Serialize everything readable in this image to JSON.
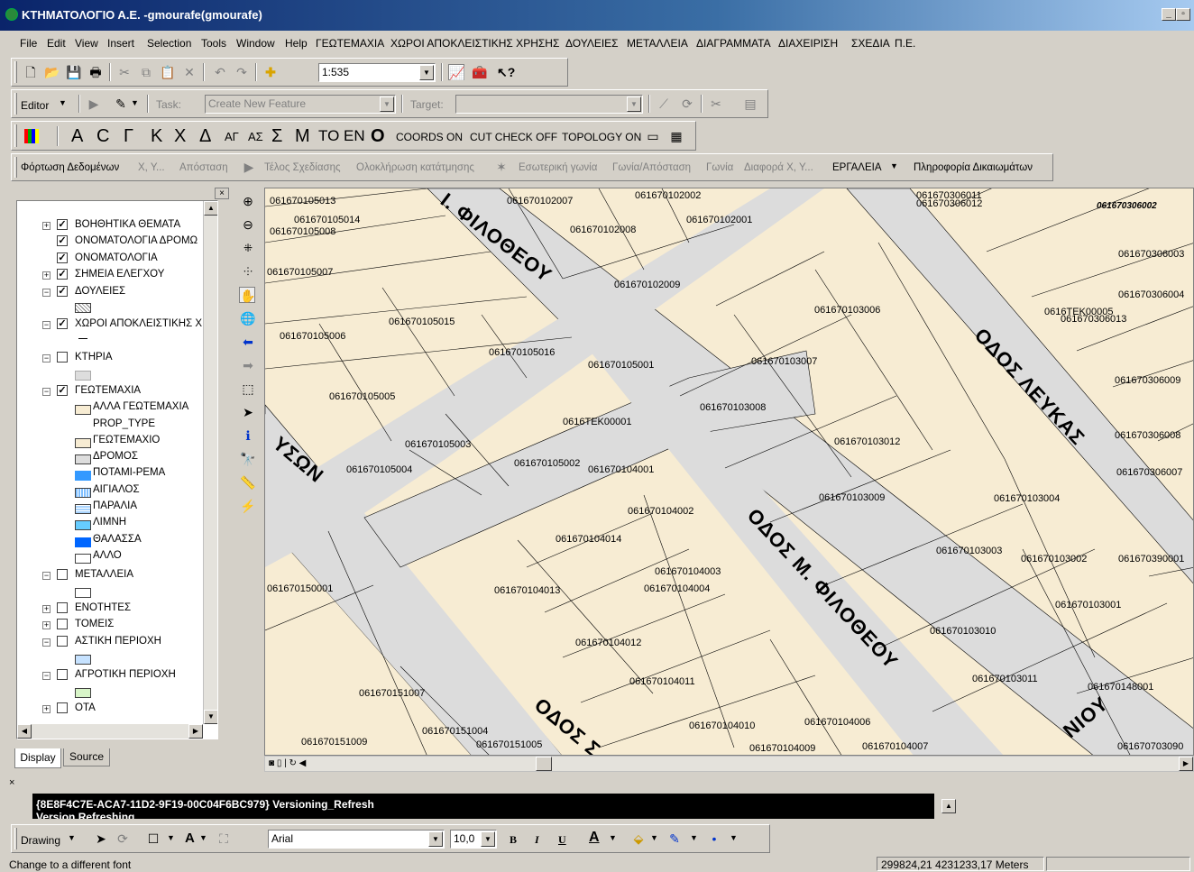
{
  "window": {
    "title": "ΚΤΗΜΑΤΟΛΟΓΙΟ Α.Ε. -gmourafe(gmourafe)",
    "min": "_",
    "restore": "▫",
    "close": "×"
  },
  "menu": [
    "File",
    "Edit",
    "View",
    "Insert",
    "Selection",
    "Tools",
    "Window",
    "Help",
    "ΓΕΩΤΕΜΑΧΙΑ",
    "ΧΩΡΟΙ ΑΠΟΚΛΕΙΣΤΙΚΗΣ ΧΡΗΣΗΣ",
    "ΔΟΥΛΕΙΕΣ",
    "ΜΕΤΑΛΛΕΙΑ",
    "ΔΙΑΓΡΑΜΜΑΤΑ",
    "ΔΙΑΧΕΙΡΙΣΗ",
    "ΣΧΕΔΙΑ",
    "Π.Ε."
  ],
  "standard": {
    "scale": "1:535"
  },
  "editor": {
    "editor_label": "Editor",
    "task_label": "Task:",
    "task_value": "Create New Feature",
    "target_label": "Target:"
  },
  "greek_toolbar": {
    "letters": [
      "Α",
      "C",
      "Γ",
      "Κ",
      "Χ",
      "Δ",
      "ΑΓ",
      "ΑΣ",
      "Σ",
      "Μ",
      "ΤΟ",
      "ΕΝ",
      "Ο"
    ],
    "coords": "COORDS ON",
    "cut": "CUT CHECK OFF",
    "topology": "TOPOLOGY ON"
  },
  "tools_toolbar": {
    "load": "Φόρτωση Δεδομένων",
    "xy": "X, Y...",
    "distance": "Απόσταση",
    "end": "Τέλος Σχεδίασης",
    "complete": "Ολοκλήρωση κατάτμησης",
    "inner": "Εσωτερική γωνία",
    "angle_dist": "Γωνία/Απόσταση",
    "angle": "Γωνία",
    "diff": "Διαφορά Χ, Υ...",
    "tools": "ΕΡΓΑΛΕΙΑ",
    "info": "Πληροφορία Δικαιωμάτων"
  },
  "toc": {
    "layers": [
      {
        "label": "ΒΟΗΘΗΤΙΚΑ ΘΕΜΑΤΑ",
        "exp": "+",
        "chk": true
      },
      {
        "label": "ΟΝΟΜΑΤΟΛΟΓΙΑ ΔΡΟΜΩ",
        "exp": "",
        "chk": true
      },
      {
        "label": "ΟΝΟΜΑΤΟΛΟΓΙΑ",
        "exp": "",
        "chk": true
      },
      {
        "label": "ΣΗΜΕΙΑ ΕΛΕΓΧΟΥ",
        "exp": "+",
        "chk": true
      },
      {
        "label": "ΔΟΥΛΕΙΕΣ",
        "exp": "−",
        "chk": true
      },
      {
        "label": "ΧΩΡΟΙ ΑΠΟΚΛΕΙΣΤΙΚΗΣ Χ",
        "exp": "−",
        "chk": true
      },
      {
        "label": "ΚΤΗΡΙΑ",
        "exp": "−",
        "chk": false
      },
      {
        "label": "ΓΕΩΤΕΜΑΧΙΑ",
        "exp": "−",
        "chk": true
      },
      {
        "label": "ΜΕΤΑΛΛΕΙΑ",
        "exp": "−",
        "chk": false
      },
      {
        "label": "ΕΝΟΤΗΤΕΣ",
        "exp": "+",
        "chk": false
      },
      {
        "label": "ΤΟΜΕΙΣ",
        "exp": "+",
        "chk": false
      },
      {
        "label": "ΑΣΤΙΚΗ ΠΕΡΙΟΧΗ",
        "exp": "−",
        "chk": false
      },
      {
        "label": "ΑΓΡΟΤΙΚΗ ΠΕΡΙΟΧΗ",
        "exp": "−",
        "chk": false
      },
      {
        "label": "ΟΤΑ",
        "exp": "+",
        "chk": false
      }
    ],
    "legend": [
      "ΑΛΛΑ ΓΕΩΤΕΜΑΧΙΑ",
      "PROP_TYPE",
      "ΓΕΩΤΕΜΑΧΙΟ",
      "ΔΡΟΜΟΣ",
      "ΠΟΤΑΜΙ-ΡΕΜΑ",
      "ΑΙΓΙΑΛΟΣ",
      "ΠΑΡΑΛΙΑ",
      "ΛΙΜΝΗ",
      "ΘΑΛΑΣΣΑ",
      "ΑΛΛΟ"
    ],
    "colors": {
      "ΠΟΤΑΜΙ-ΡΕΜΑ": "#3399ff",
      "ΑΙΓΙΑΛΟΣ": "#7fbfff",
      "ΠΑΡΑΛΙΑ": "#a8d4ff",
      "ΛΙΜΝΗ": "#66ccff",
      "ΘΑΛΑΣΣΑ": "#0066ff",
      "ΑΣΤΙΚΗ": "#c6e2ff",
      "ΑΓΡΟΤΙΚΗ": "#d8f5c8"
    },
    "tab_display": "Display",
    "tab_source": "Source"
  },
  "map": {
    "roads": [
      {
        "label": "Ι. ΦΙΛΟΘΕΟΥ"
      },
      {
        "label": "ΟΔΟΣ ΛΕΥΚΑΣ"
      },
      {
        "label": "ΟΔΟΣ Μ. ΦΙΛΟΘΕΟΥ"
      },
      {
        "label": "ΥΣΩΝ"
      },
      {
        "label": "ΟΔΟΣ Σ"
      },
      {
        "label": "ΝΙΟΥ"
      }
    ],
    "parcels": [
      "061670105013",
      "061670105014",
      "061670105008",
      "061670102007",
      "061670102002",
      "061670102001",
      "061670102008",
      "061670306011",
      "061670306012",
      "061670306002",
      "061670105007",
      "061670102009",
      "061670306003",
      "061670306004",
      "061670103006",
      "0616ΤΕΚ00005",
      "061670306013",
      "061670105015",
      "061670105006",
      "061670105016",
      "061670105001",
      "061670103007",
      "061670306009",
      "061670105005",
      "061670103008",
      "0616ΤΕΚ00001",
      "061670103012",
      "061670306008",
      "061670105003",
      "061670105004",
      "061670105002",
      "061670104001",
      "061670306007",
      "061670103009",
      "061670103004",
      "061670104002",
      "061670104014",
      "061670103003",
      "061670103002",
      "061670390001",
      "061670150001",
      "061670104013",
      "061670104003",
      "061670104004",
      "061670103001",
      "061670104012",
      "061670103010",
      "061670104011",
      "061670103011",
      "061670148001",
      "061670151007",
      "061670151004",
      "061670151009",
      "061670151005",
      "061670104010",
      "061670104006",
      "061670104009",
      "061670104007",
      "061670703090"
    ]
  },
  "command": {
    "line1": "{8E8F4C7E-ACA7-11D2-9F19-00C04F6BC979}   Versioning_Refresh",
    "line2": "Version Refreshing"
  },
  "drawing": {
    "label": "Drawing",
    "font": "Arial",
    "size": "10,0",
    "bold": "B",
    "italic": "I",
    "underline": "U",
    "text": "A"
  },
  "status": {
    "message": "Change to a different font",
    "coords": "299824,21  4231233,17 Meters"
  }
}
